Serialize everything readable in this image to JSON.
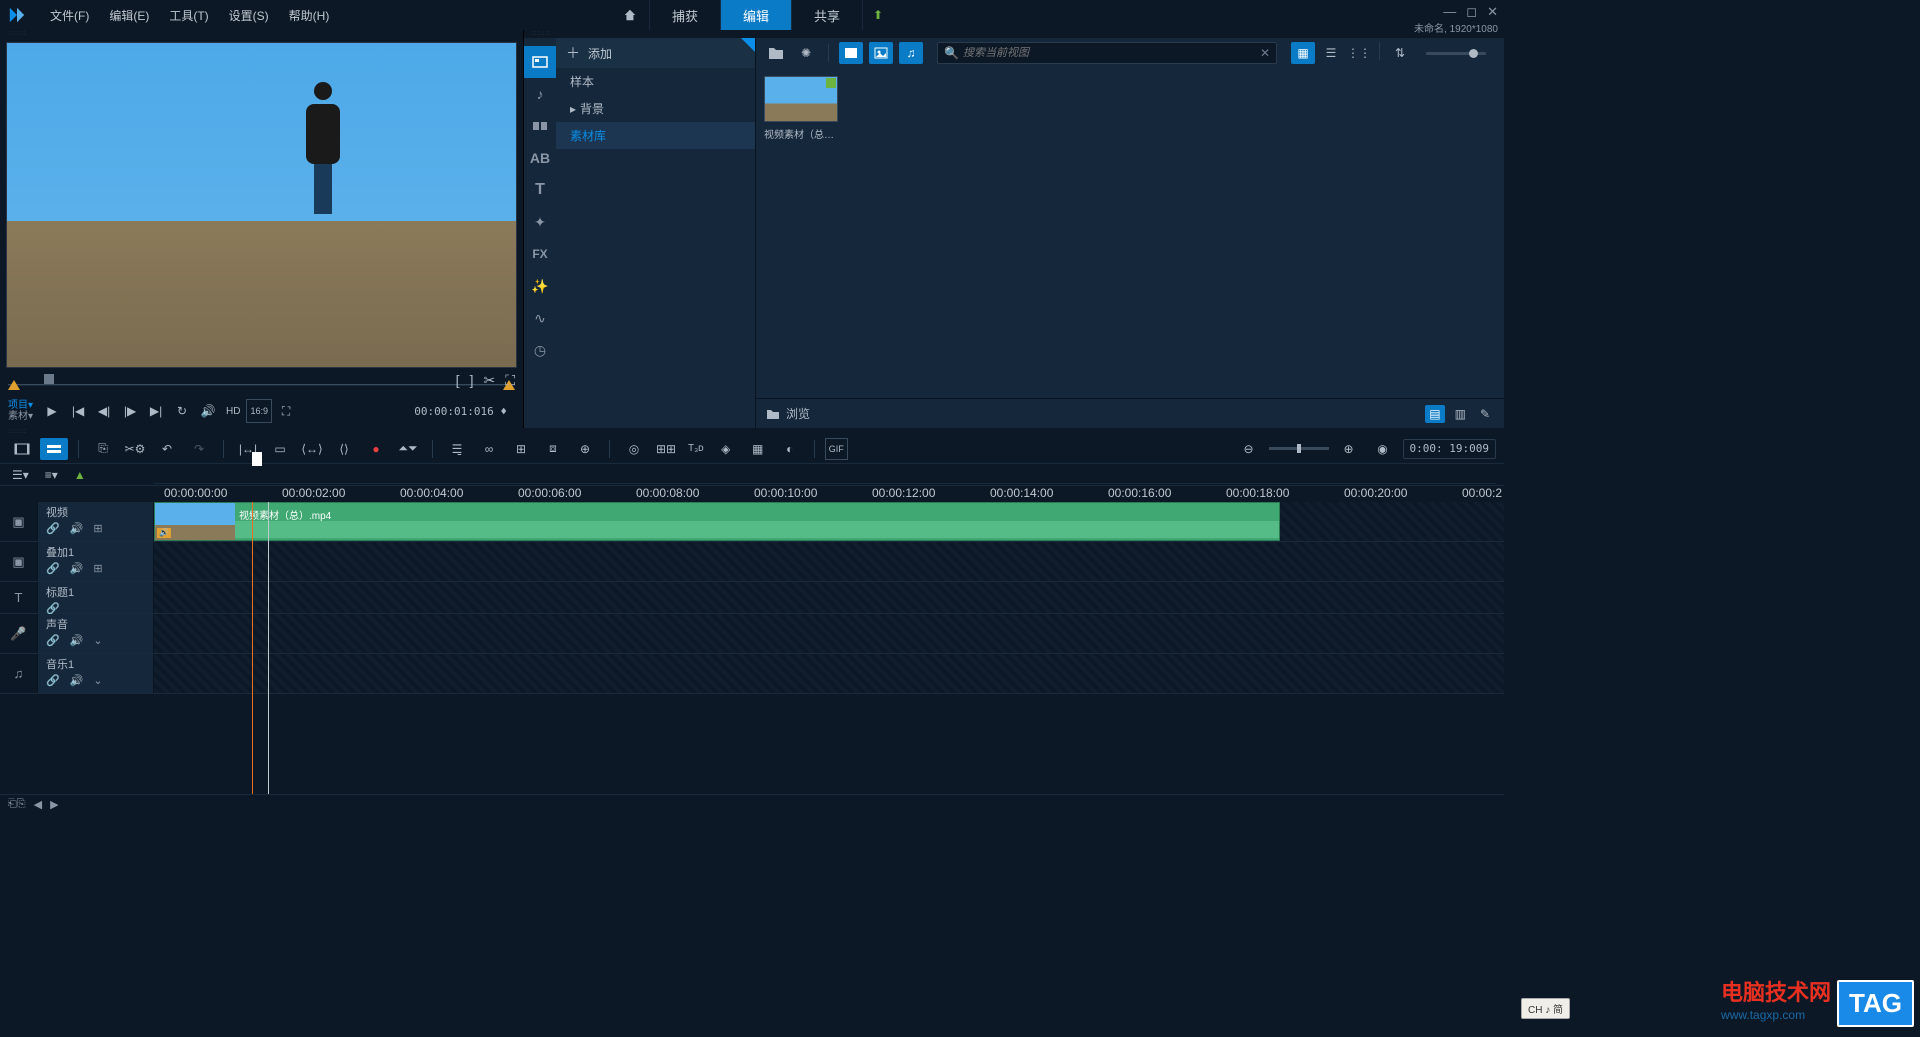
{
  "menubar": {
    "items": [
      "文件(F)",
      "编辑(E)",
      "工具(T)",
      "设置(S)",
      "帮助(H)"
    ],
    "tabs": {
      "capture": "捕获",
      "edit": "编辑",
      "share": "共享"
    },
    "project_info": "未命名, 1920*1080"
  },
  "preview": {
    "mode_label_top": "项目▾",
    "mode_label_bottom": "素材▾",
    "hd_label": "HD",
    "aspect_label": "16:9",
    "timecode": "00:00:01:016 ♦"
  },
  "library": {
    "add_label": "添加",
    "tree": {
      "sample": "样本",
      "background": "背景",
      "asset_lib": "素材库"
    },
    "search_placeholder": "搜索当前视图",
    "item_label": "视频素材（总）...",
    "browse_label": "浏览"
  },
  "timeline": {
    "toolbar_timecode": "0:00: 19:009",
    "ruler_ticks": [
      "00:00:00:00",
      "00:00:02:00",
      "00:00:04:00",
      "00:00:06:00",
      "00:00:08:00",
      "00:00:10:00",
      "00:00:12:00",
      "00:00:14:00",
      "00:00:16:00",
      "00:00:18:00",
      "00:00:20:00",
      "00:00:2"
    ],
    "tracks": {
      "video": "视频",
      "overlay": "叠加1",
      "title": "标题1",
      "voice": "声音",
      "music": "音乐1"
    },
    "clip_label": "视频素材（总）.mp4"
  },
  "ime_badge": "CH ♪ 简",
  "watermark": {
    "title": "电脑技术网",
    "url": "www.tagxp.com",
    "tag": "TAG"
  }
}
